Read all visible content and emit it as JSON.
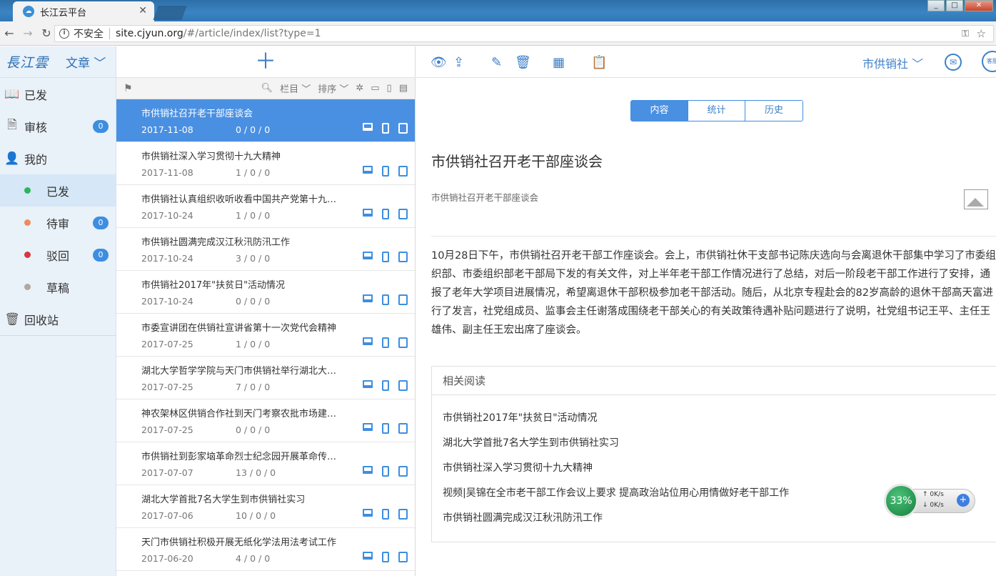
{
  "browser": {
    "tab_title": "长江云平台",
    "security_label": "不安全",
    "url_host": "site.cjyun.org",
    "url_path": "/#/article/index/list?type=1"
  },
  "sidebar": {
    "logo": "長江雲",
    "module": "文章 ﹀",
    "items": [
      {
        "label": "已发"
      },
      {
        "label": "审核",
        "count": "0"
      },
      {
        "label": "我的"
      }
    ],
    "sub_items": [
      {
        "label": "已发",
        "color": "#2db55d"
      },
      {
        "label": "待审",
        "color": "#f08a5d",
        "count": "0"
      },
      {
        "label": "驳回",
        "color": "#d9363e",
        "count": "0"
      },
      {
        "label": "草稿",
        "color": "#b0a8a0"
      }
    ],
    "trash": "回收站"
  },
  "list": {
    "filter_column": "栏目 ﹀",
    "filter_sort": "排序 ﹀",
    "rows": [
      {
        "title": "市供销社召开老干部座谈会",
        "date": "2017-11-08",
        "stats": "0 / 0 / 0"
      },
      {
        "title": "市供销社深入学习贯彻十九大精神",
        "date": "2017-11-08",
        "stats": "1 / 0 / 0"
      },
      {
        "title": "市供销社认真组织收听收看中国共产党第十九…",
        "date": "2017-10-24",
        "stats": "1 / 0 / 0"
      },
      {
        "title": "市供销社圆满完成汉江秋汛防汛工作",
        "date": "2017-10-24",
        "stats": "3 / 0 / 0"
      },
      {
        "title": "市供销社2017年\"扶贫日\"活动情况",
        "date": "2017-10-24",
        "stats": "0 / 0 / 0"
      },
      {
        "title": "市委宣讲团在供销社宣讲省第十一次党代会精神",
        "date": "2017-07-25",
        "stats": "1 / 0 / 0"
      },
      {
        "title": "湖北大学哲学学院与天门市供销社举行湖北大…",
        "date": "2017-07-25",
        "stats": "7 / 0 / 0"
      },
      {
        "title": "神农架林区供销合作社到天门考察农批市场建…",
        "date": "2017-07-25",
        "stats": "0 / 0 / 0"
      },
      {
        "title": "市供销社到彭家垴革命烈士纪念园开展革命传…",
        "date": "2017-07-07",
        "stats": "13 / 0 / 0"
      },
      {
        "title": "湖北大学首批7名大学生到市供销社实习",
        "date": "2017-07-06",
        "stats": "10 / 0 / 0"
      },
      {
        "title": "天门市供销社积极开展无纸化学法用法考试工作",
        "date": "2017-06-20",
        "stats": "4 / 0 / 0"
      }
    ]
  },
  "detail": {
    "org": "市供销社 ﹀",
    "tabs": [
      "内容",
      "统计",
      "历史"
    ],
    "title": "市供销社召开老干部座谈会",
    "summary": "市供销社召开老干部座谈会",
    "body": "10月28日下午，市供销社召开老干部工作座谈会。会上，市供销社休干支部书记陈庆选向与会离退休干部集中学习了市委组织部、市委组织部老干部局下发的有关文件，对上半年老干部工作情况进行了总结，对后一阶段老干部工作进行了安排，通报了老年大学项目进展情况，希望离退休干部积极参加老干部活动。随后，从北京专程赴会的82岁高龄的退休干部高天富进行了发言，社党组成员、监事会主任谢落成围绕老干部关心的有关政策待遇补贴问题进行了说明，社党组书记王平、主任王雄伟、副主任王宏出席了座谈会。",
    "related_heading": "相关阅读",
    "related": [
      "市供销社2017年\"扶贫日\"活动情况",
      "湖北大学首批7名大学生到市供销社实习",
      "市供销社深入学习贯彻十九大精神",
      "视频|吴锦在全市老干部工作会议上要求 提高政治站位用心用情做好老干部工作",
      "市供销社圆满完成汉江秋汛防汛工作"
    ]
  },
  "widget": {
    "percent": "33%",
    "up": "0K/s",
    "down": "0K/s"
  },
  "colors": {
    "accent": "#4a90e2",
    "brand": "#2c6fb4"
  }
}
